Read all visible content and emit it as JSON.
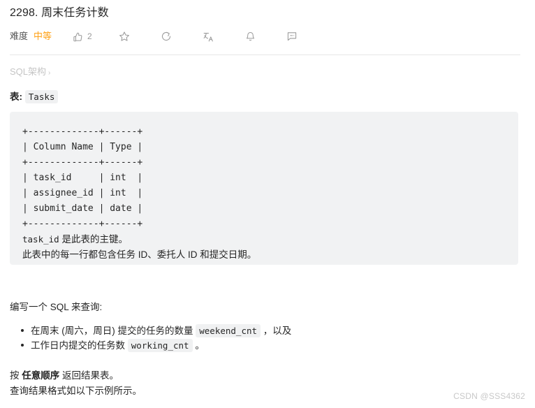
{
  "problem": {
    "title": "2298. 周末任务计数",
    "difficulty_label": "难度",
    "difficulty_value": "中等",
    "difficulty_color": "#ffa116"
  },
  "toolbar": {
    "like_icon": "thumbs-up-icon",
    "like_count": "2",
    "star_icon": "star-icon",
    "share_icon": "share-icon",
    "translate_icon": "translate-icon",
    "bell_icon": "bell-icon",
    "comment_icon": "comment-icon"
  },
  "breadcrumb": {
    "label": "SQL架构",
    "chevron": "›"
  },
  "table_section": {
    "label": "表:",
    "name": "Tasks"
  },
  "schema": {
    "ascii": "+-------------+------+\n| Column Name | Type |\n+-------------+------+\n| task_id     | int  |\n| assignee_id | int  |\n| submit_date | date |\n+-------------+------+",
    "note_code": "task_id",
    "note_text": " 是此表的主键。",
    "description": "此表中的每一行都包含任务 ID、委托人 ID 和提交日期。"
  },
  "body": {
    "intro": "编写一个 SQL 来查询:",
    "bullets": [
      {
        "text_before": "在周末 (周六，周日) 提交的任务的数量 ",
        "code": "weekend_cnt",
        "text_after": " ，以及"
      },
      {
        "text_before": "工作日内提交的任务数 ",
        "code": "working_cnt",
        "text_after": " 。"
      }
    ],
    "order_before": "按 ",
    "order_bold": "任意顺序",
    "order_after": " 返回结果表。",
    "format_note": "查询结果格式如以下示例所示。"
  },
  "watermark": {
    "text": "CSDN @SSS4362"
  }
}
